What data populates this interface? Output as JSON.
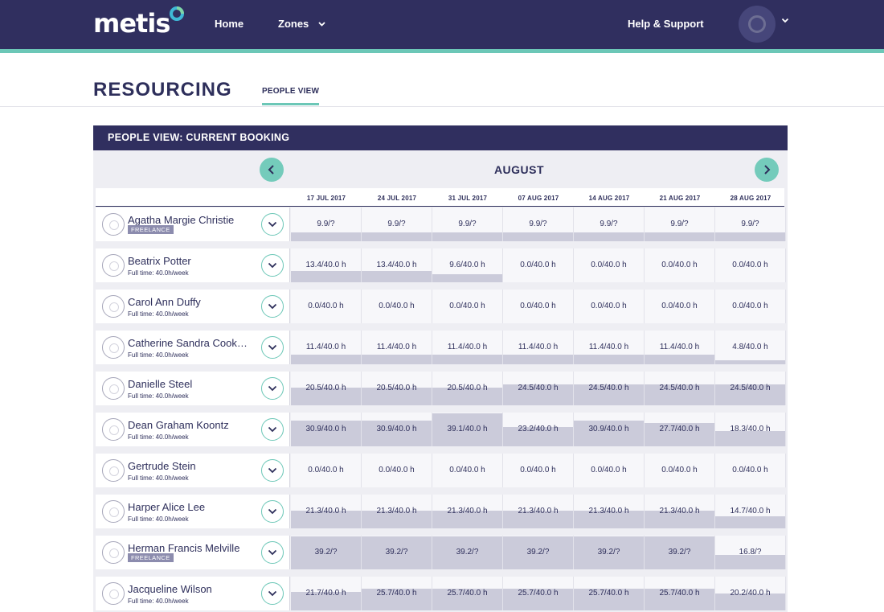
{
  "app": {
    "logo": "metis",
    "nav": {
      "home": "Home",
      "zones": "Zones",
      "help": "Help & Support"
    }
  },
  "page": {
    "title": "RESOURCING",
    "tab": "PEOPLE VIEW"
  },
  "panel": {
    "title": "PEOPLE VIEW: CURRENT BOOKING",
    "month": "AUGUST",
    "dates": [
      "17 JUL 2017",
      "24 JUL 2017",
      "31 JUL 2017",
      "07 AUG 2017",
      "14 AUG 2017",
      "21 AUG 2017",
      "28 AUG 2017"
    ]
  },
  "people": [
    {
      "name": "Agatha Margie Christie",
      "badge": "FREELANCE",
      "sub": "",
      "cells": [
        {
          "label": "9.9/?",
          "fill": 0.25
        },
        {
          "label": "9.9/?",
          "fill": 0.25
        },
        {
          "label": "9.9/?",
          "fill": 0.25
        },
        {
          "label": "9.9/?",
          "fill": 0.25
        },
        {
          "label": "9.9/?",
          "fill": 0.25
        },
        {
          "label": "9.9/?",
          "fill": 0.25
        },
        {
          "label": "9.9/?",
          "fill": 0.25
        }
      ]
    },
    {
      "name": "Beatrix Potter",
      "badge": "",
      "sub": "Full time: 40.0h/week",
      "cells": [
        {
          "label": "13.4/40.0 h",
          "fill": 0.335
        },
        {
          "label": "13.4/40.0 h",
          "fill": 0.335
        },
        {
          "label": "9.6/40.0 h",
          "fill": 0.24
        },
        {
          "label": "0.0/40.0 h",
          "fill": 0
        },
        {
          "label": "0.0/40.0 h",
          "fill": 0
        },
        {
          "label": "0.0/40.0 h",
          "fill": 0
        },
        {
          "label": "0.0/40.0 h",
          "fill": 0
        }
      ]
    },
    {
      "name": "Carol Ann Duffy",
      "badge": "",
      "sub": "Full time: 40.0h/week",
      "cells": [
        {
          "label": "0.0/40.0 h",
          "fill": 0
        },
        {
          "label": "0.0/40.0 h",
          "fill": 0
        },
        {
          "label": "0.0/40.0 h",
          "fill": 0
        },
        {
          "label": "0.0/40.0 h",
          "fill": 0
        },
        {
          "label": "0.0/40.0 h",
          "fill": 0
        },
        {
          "label": "0.0/40.0 h",
          "fill": 0
        },
        {
          "label": "0.0/40.0 h",
          "fill": 0
        }
      ]
    },
    {
      "name": "Catherine Sandra Cookson",
      "badge": "",
      "sub": "Full time: 40.0h/week",
      "cells": [
        {
          "label": "11.4/40.0 h",
          "fill": 0.285
        },
        {
          "label": "11.4/40.0 h",
          "fill": 0.285
        },
        {
          "label": "11.4/40.0 h",
          "fill": 0.285
        },
        {
          "label": "11.4/40.0 h",
          "fill": 0.285
        },
        {
          "label": "11.4/40.0 h",
          "fill": 0.285
        },
        {
          "label": "11.4/40.0 h",
          "fill": 0.285
        },
        {
          "label": "4.8/40.0 h",
          "fill": 0.12
        }
      ]
    },
    {
      "name": "Danielle Steel",
      "badge": "",
      "sub": "Full time: 40.0h/week",
      "cells": [
        {
          "label": "20.5/40.0 h",
          "fill": 0.5125
        },
        {
          "label": "20.5/40.0 h",
          "fill": 0.5125
        },
        {
          "label": "20.5/40.0 h",
          "fill": 0.5125
        },
        {
          "label": "24.5/40.0 h",
          "fill": 0.6125
        },
        {
          "label": "24.5/40.0 h",
          "fill": 0.6125
        },
        {
          "label": "24.5/40.0 h",
          "fill": 0.6125
        },
        {
          "label": "24.5/40.0 h",
          "fill": 0.6125
        }
      ]
    },
    {
      "name": "Dean Graham Koontz",
      "badge": "",
      "sub": "Full time: 40.0h/week",
      "cells": [
        {
          "label": "30.9/40.0 h",
          "fill": 0.7725
        },
        {
          "label": "30.9/40.0 h",
          "fill": 0.7725
        },
        {
          "label": "39.1/40.0 h",
          "fill": 0.9775
        },
        {
          "label": "23.2/40.0 h",
          "fill": 0.58
        },
        {
          "label": "30.9/40.0 h",
          "fill": 0.7725
        },
        {
          "label": "27.7/40.0 h",
          "fill": 0.6925
        },
        {
          "label": "18.3/40.0 h",
          "fill": 0.4575
        }
      ]
    },
    {
      "name": "Gertrude Stein",
      "badge": "",
      "sub": "Full time: 40.0h/week",
      "cells": [
        {
          "label": "0.0/40.0 h",
          "fill": 0
        },
        {
          "label": "0.0/40.0 h",
          "fill": 0
        },
        {
          "label": "0.0/40.0 h",
          "fill": 0
        },
        {
          "label": "0.0/40.0 h",
          "fill": 0
        },
        {
          "label": "0.0/40.0 h",
          "fill": 0
        },
        {
          "label": "0.0/40.0 h",
          "fill": 0
        },
        {
          "label": "0.0/40.0 h",
          "fill": 0
        }
      ]
    },
    {
      "name": "Harper Alice Lee",
      "badge": "",
      "sub": "Full time: 40.0h/week",
      "cells": [
        {
          "label": "21.3/40.0 h",
          "fill": 0.5325
        },
        {
          "label": "21.3/40.0 h",
          "fill": 0.5325
        },
        {
          "label": "21.3/40.0 h",
          "fill": 0.5325
        },
        {
          "label": "21.3/40.0 h",
          "fill": 0.5325
        },
        {
          "label": "21.3/40.0 h",
          "fill": 0.5325
        },
        {
          "label": "21.3/40.0 h",
          "fill": 0.5325
        },
        {
          "label": "14.7/40.0 h",
          "fill": 0.3675
        }
      ]
    },
    {
      "name": "Herman Francis Melville",
      "badge": "FREELANCE",
      "sub": "",
      "cells": [
        {
          "label": "39.2/?",
          "fill": 0.98
        },
        {
          "label": "39.2/?",
          "fill": 0.98
        },
        {
          "label": "39.2/?",
          "fill": 0.98
        },
        {
          "label": "39.2/?",
          "fill": 0.98
        },
        {
          "label": "39.2/?",
          "fill": 0.98
        },
        {
          "label": "39.2/?",
          "fill": 0.98
        },
        {
          "label": "16.8/?",
          "fill": 0.42
        }
      ]
    },
    {
      "name": "Jacqueline Wilson",
      "badge": "",
      "sub": "Full time: 40.0h/week",
      "cells": [
        {
          "label": "21.7/40.0 h",
          "fill": 0.5425
        },
        {
          "label": "25.7/40.0 h",
          "fill": 0.6425
        },
        {
          "label": "25.7/40.0 h",
          "fill": 0.6425
        },
        {
          "label": "25.7/40.0 h",
          "fill": 0.6425
        },
        {
          "label": "25.7/40.0 h",
          "fill": 0.6425
        },
        {
          "label": "25.7/40.0 h",
          "fill": 0.6425
        },
        {
          "label": "20.2/40.0 h",
          "fill": 0.505
        }
      ]
    }
  ]
}
